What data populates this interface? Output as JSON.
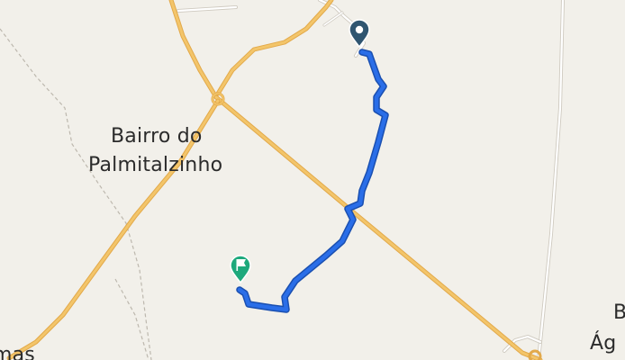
{
  "map": {
    "labels": {
      "bairro_line1": "Bairro do",
      "bairro_line2": "Palmitalzinho",
      "right_edge_line1": "B",
      "right_edge_line2": "Ág",
      "left_edge": "mas"
    },
    "colors": {
      "background": "#f2f0ea",
      "highway": "#f3c56a",
      "highway_casing": "#e2a94a",
      "minor_road": "#ffffff",
      "minor_road_casing": "#cfcac0",
      "dirt_track": "#bdb8ae",
      "route": "#2a6ee8",
      "route_casing": "#1a4fb0",
      "start_marker": "#2f5570",
      "end_marker": "#1ea97c"
    },
    "markers": [
      {
        "role": "start",
        "icon": "map-pin-icon"
      },
      {
        "role": "destination",
        "icon": "flag-icon"
      }
    ]
  }
}
